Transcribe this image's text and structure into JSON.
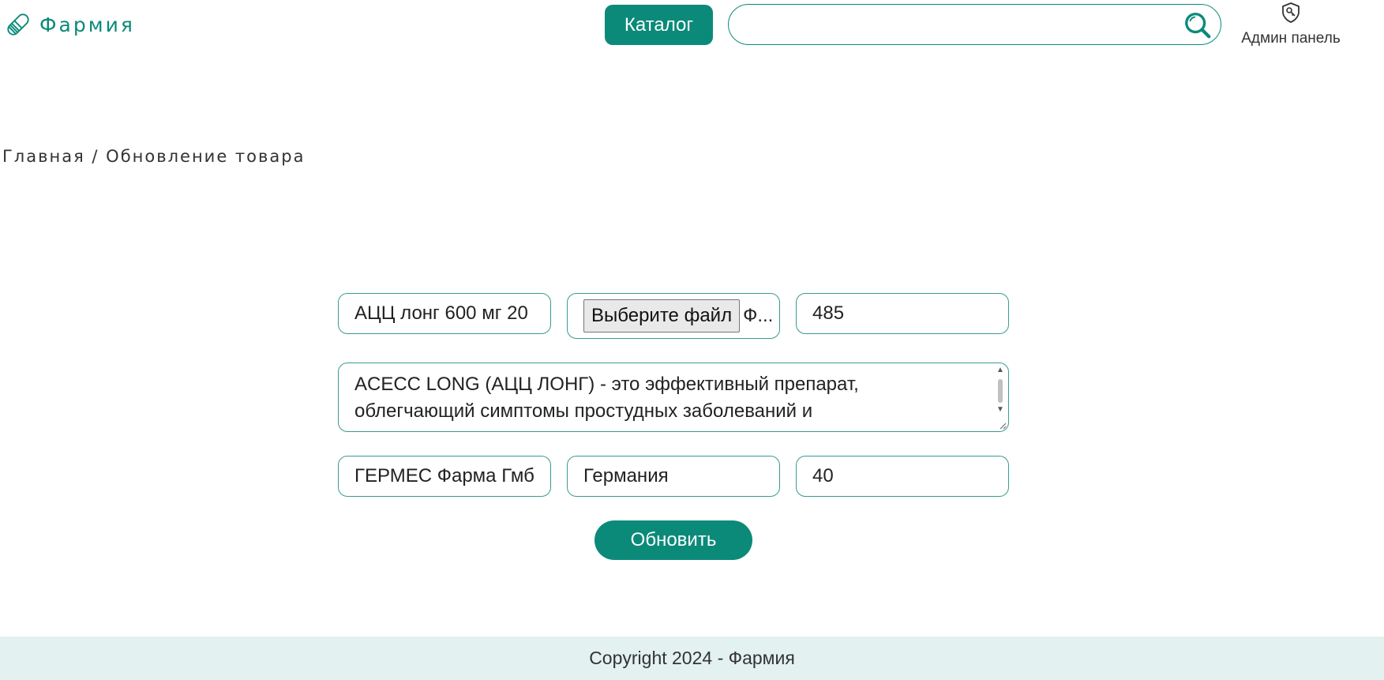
{
  "header": {
    "logo_text": "Фармия",
    "catalog_label": "Каталог",
    "search": {
      "placeholder": "",
      "value": ""
    },
    "admin_label": "Админ панель"
  },
  "breadcrumb": {
    "home": "Главная",
    "separator": "/",
    "current": "Обновление товара"
  },
  "form": {
    "name_value": "АЦЦ лонг 600 мг 20",
    "file_button_label": "Выберите файл",
    "file_name": "Ф...",
    "price_value": "485",
    "description_value": "ACECC LONG (АЦЦ ЛОНГ) - это эффективный препарат, облегчающий симптомы простудных заболеваний и",
    "manufacturer_value": "ГЕРМЕС Фарма Гмб",
    "country_value": "Германия",
    "quantity_value": "40",
    "submit_label": "Обновить"
  },
  "footer": {
    "copyright": "Copyright 2024 - Фармия"
  },
  "colors": {
    "accent": "#0b8a7a",
    "field_border": "#3a9c8e",
    "footer_bg": "#e3f1f0"
  },
  "icons": {
    "logo": "pill-icon",
    "search": "search-icon",
    "admin": "shield-key-icon"
  }
}
